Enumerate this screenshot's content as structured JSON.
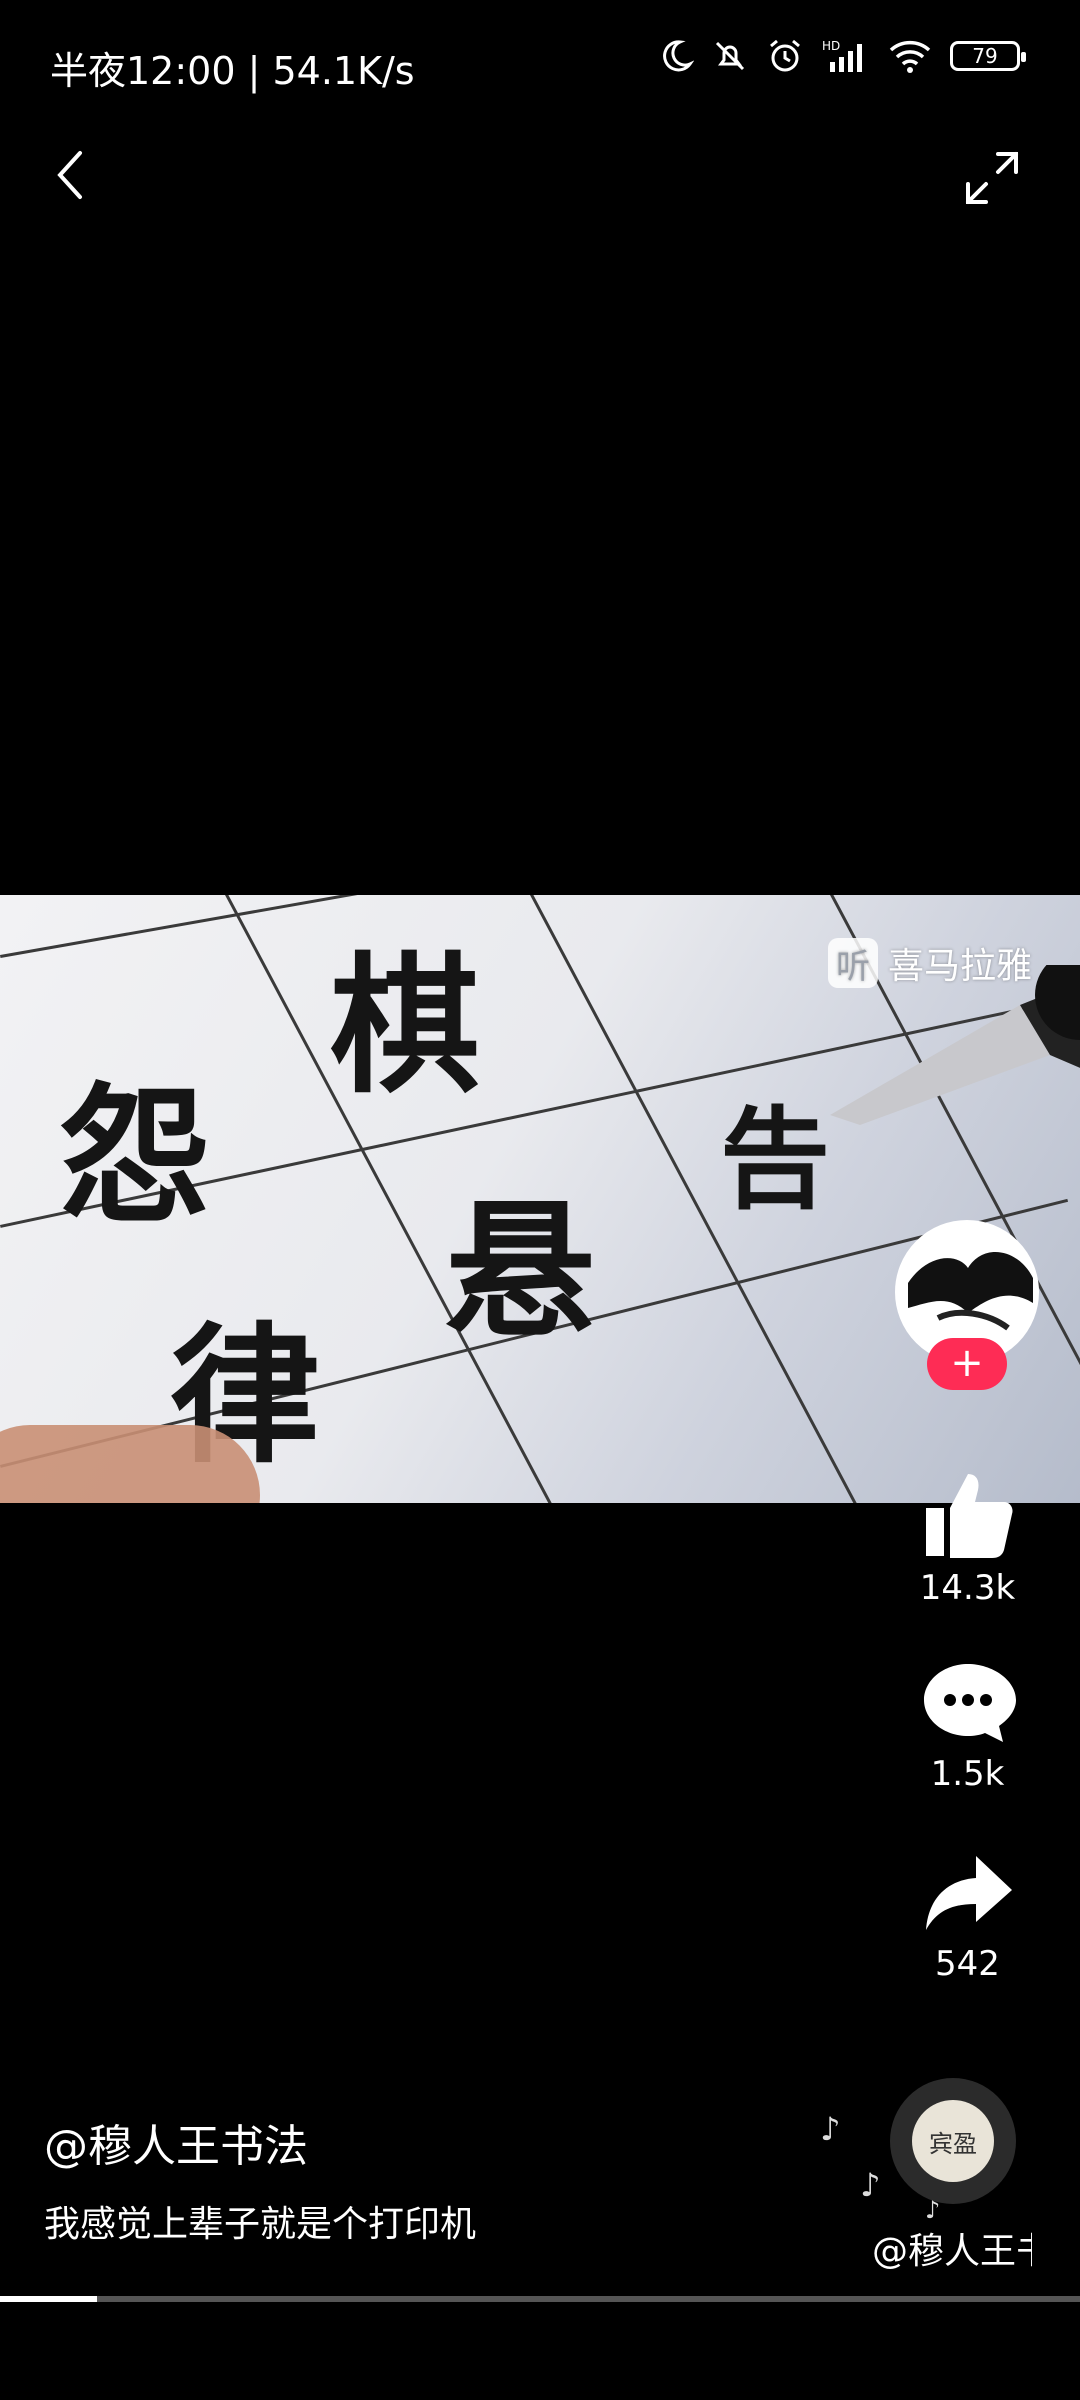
{
  "status_bar": {
    "time_speed": "半夜12:00 | 54.1K/s",
    "battery": "79",
    "signal_label": "HD"
  },
  "video": {
    "watermark_text": "喜马拉雅",
    "watermark_icon_char": "听",
    "chars": [
      "怨",
      "棋",
      "律",
      "悬",
      "告"
    ]
  },
  "actions": {
    "follow": "+",
    "likes": "14.3k",
    "comments": "1.5k",
    "shares": "542"
  },
  "post": {
    "author": "@穆人王书法",
    "caption": "我感觉上辈子就是个打印机",
    "music_author": "@穆人王书",
    "disc_text": "宾盈"
  },
  "progress": {
    "fraction": 0.09
  },
  "colors": {
    "follow_red": "#fe2c55"
  }
}
